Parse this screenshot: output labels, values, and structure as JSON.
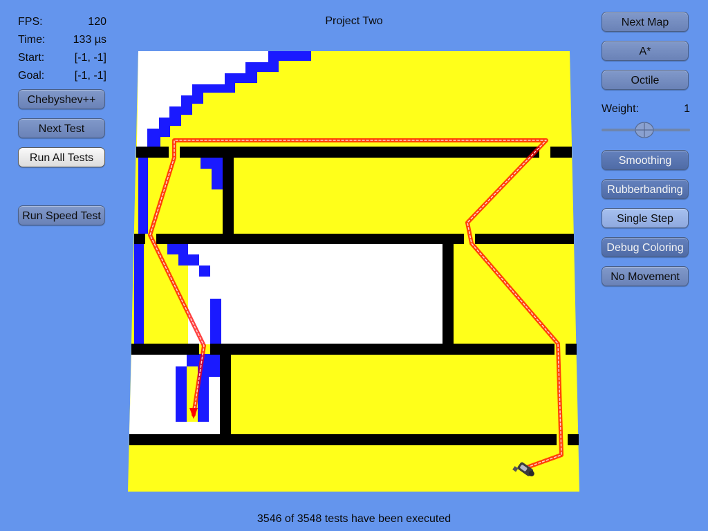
{
  "title": "Project Two",
  "stats": [
    {
      "label": "FPS:",
      "value": "120"
    },
    {
      "label": "Time:",
      "value": "133 µs"
    },
    {
      "label": "Start:",
      "value": "[-1, -1]"
    },
    {
      "label": "Goal:",
      "value": "[-1, -1]"
    }
  ],
  "left_buttons": {
    "heuristic": "Chebyshev++",
    "next_test": "Next Test",
    "run_all_tests": "Run All Tests",
    "run_speed_test": "Run Speed Test"
  },
  "right_buttons": {
    "next_map": "Next Map",
    "algorithm": "A*",
    "distance": "Octile",
    "smoothing": "Smoothing",
    "rubberbanding": "Rubberbanding",
    "single_step": "Single Step",
    "debug_coloring": "Debug Coloring",
    "no_movement": "No Movement"
  },
  "weight": {
    "label": "Weight:",
    "value": "1",
    "slider_level": 0.5
  },
  "status": "3546 of 3548 tests have been executed",
  "colors": {
    "background": "#6495ed",
    "open": "#ffff1a",
    "unexplored": "#ffffff",
    "closed": "#1a1aff",
    "wall": "#000000",
    "path": "#ff0000"
  },
  "icons": {
    "agent": "robot-agent-icon",
    "slider": "slider-thumb-icon"
  }
}
